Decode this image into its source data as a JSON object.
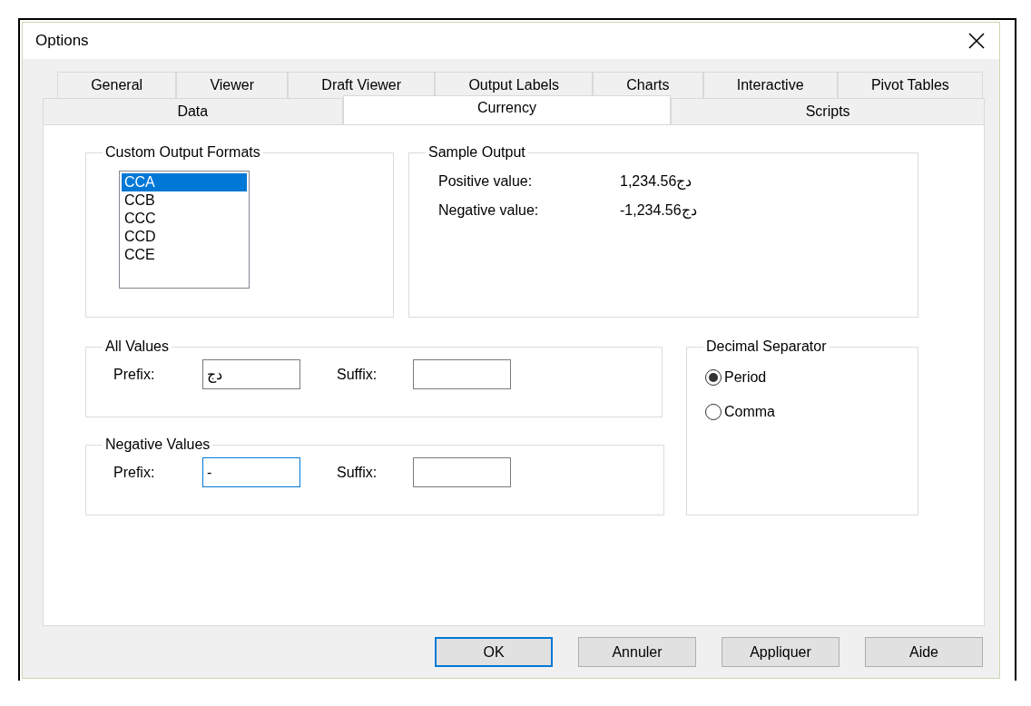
{
  "window": {
    "title": "Options"
  },
  "tab_rows": [
    [
      {
        "label": "General",
        "selected": false
      },
      {
        "label": "Viewer",
        "selected": false
      },
      {
        "label": "Draft Viewer",
        "selected": false
      },
      {
        "label": "Output Labels",
        "selected": false
      },
      {
        "label": "Charts",
        "selected": false
      },
      {
        "label": "Interactive",
        "selected": false
      },
      {
        "label": "Pivot Tables",
        "selected": false
      }
    ],
    [
      {
        "label": "Data",
        "selected": false
      },
      {
        "label": "Currency",
        "selected": true
      },
      {
        "label": "Scripts",
        "selected": false
      }
    ]
  ],
  "custom_output_formats": {
    "title": "Custom Output Formats",
    "items": [
      {
        "label": "CCA",
        "selected": true
      },
      {
        "label": "CCB",
        "selected": false
      },
      {
        "label": "CCC",
        "selected": false
      },
      {
        "label": "CCD",
        "selected": false
      },
      {
        "label": "CCE",
        "selected": false
      }
    ]
  },
  "sample_output": {
    "title": "Sample Output",
    "rows": [
      {
        "label": "Positive value:",
        "value": "1,234.56دج"
      },
      {
        "label": "Negative value:",
        "value": "-1,234.56دج"
      }
    ]
  },
  "all_values": {
    "title": "All Values",
    "prefix_label": "Prefix:",
    "prefix": "دج",
    "prefix_focused": false,
    "suffix_label": "Suffix:"
  },
  "negative_values": {
    "title": "Negative Values",
    "prefix_label": "Prefix:",
    "prefix": "-",
    "prefix_focused": true,
    "suffix_label": "Suffix:"
  },
  "decimal_separator": {
    "title": "Decimal Separator",
    "options": [
      {
        "label": "Period",
        "selected": true
      },
      {
        "label": "Comma",
        "selected": false
      }
    ]
  },
  "buttons": [
    {
      "label": "OK",
      "default": true
    },
    {
      "label": "Annuler",
      "default": false
    },
    {
      "label": "Appliquer",
      "default": false
    },
    {
      "label": "Aide",
      "default": false
    }
  ]
}
